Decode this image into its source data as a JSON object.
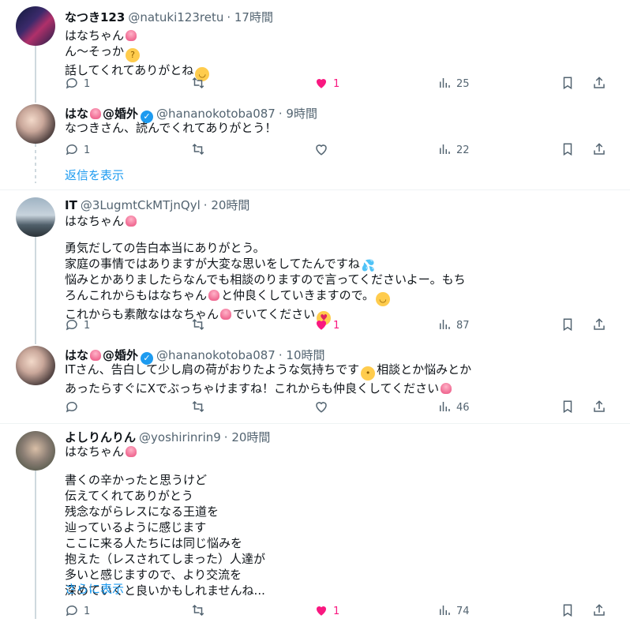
{
  "posts": [
    {
      "name": "なつき123",
      "handle": "@natuki123retu",
      "time": "· 17時間",
      "lines": [
        "はなちゃん",
        "ん〜そっか",
        "話してくれてありがとね"
      ],
      "counts": {
        "replies": "1",
        "likes": "1",
        "views": "25"
      },
      "liked": true
    },
    {
      "name": "はな",
      "name_suffix": "@婚外",
      "handle": "@hananokotoba087",
      "time": "· 9時間",
      "lines": [
        "なつきさん、読んでくれてありがとう！"
      ],
      "counts": {
        "replies": "1",
        "likes": "",
        "views": "22"
      },
      "liked": false
    },
    {
      "name": "IT",
      "handle": "@3LugmtCkMTjnQyl",
      "time": "· 20時間",
      "lines": [
        "はなちゃん",
        "勇気だしての告白本当にありがとう。",
        "家庭の事情ではありますが大変な思いをしてたんですね",
        "悩みとかありましたらなんでも相談のりますので言ってくださいよー。もち",
        "ろんこれからもはなちゃん",
        "と仲良くしていきますので。",
        "これからも素敵なはなちゃん",
        "でいてください"
      ],
      "counts": {
        "replies": "1",
        "likes": "1",
        "views": "87"
      },
      "liked": true
    },
    {
      "name": "はな",
      "name_suffix": "@婚外",
      "handle": "@hananokotoba087",
      "time": "· 10時間",
      "lines": [
        "ITさん、告白して少し肩の荷がおりたような気持ちです",
        "相談とか悩みとか",
        "あったらすぐにXでぶっちゃけますね！これからも仲良くしてください"
      ],
      "counts": {
        "replies": "",
        "likes": "",
        "views": "46"
      },
      "liked": false
    },
    {
      "name": "よしりんりん",
      "handle": "@yoshirinrin9",
      "time": "· 20時間",
      "lines": [
        "はなちゃん",
        "書くの辛かったと思うけど",
        "伝えてくれてありがとう",
        "残念ながらレスになる王道を",
        "辿っているように感じます",
        "ここに来る人たちには同じ悩みを",
        "抱えた（レスされてしまった）人達が",
        "多いと感じますので、より交流を",
        "深めていくと良いかもしれませんね..."
      ],
      "counts": {
        "replies": "1",
        "likes": "1",
        "views": "74"
      },
      "liked": true
    }
  ],
  "show_replies_label": "返信を表示",
  "show_more_label": "さらに表示",
  "colors": {
    "like": "#f91880",
    "link": "#1d9bf0",
    "muted": "#536471"
  },
  "icons": [
    "reply-icon",
    "retweet-icon",
    "heart-icon",
    "views-icon",
    "bookmark-icon",
    "share-icon",
    "verified-icon"
  ]
}
